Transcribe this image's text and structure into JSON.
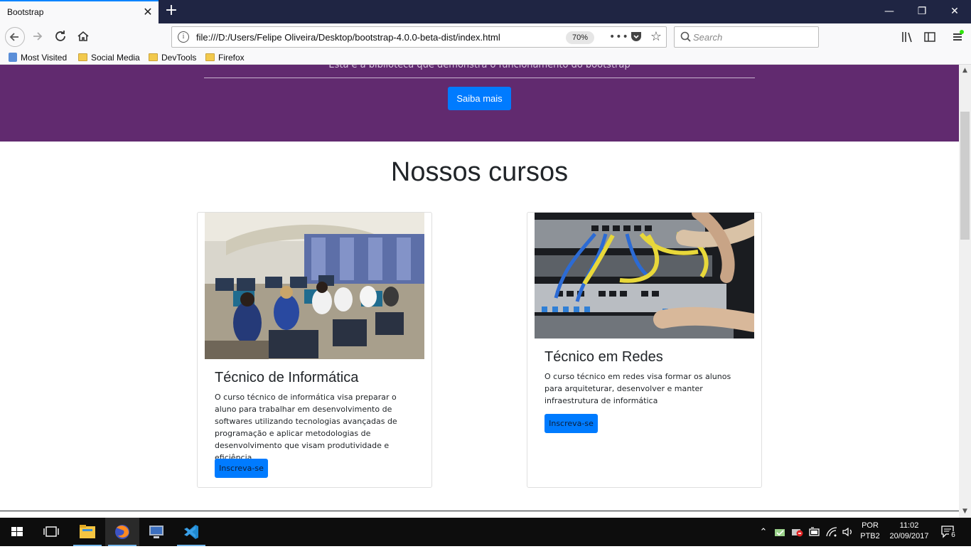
{
  "browser": {
    "tab_title": "Bootstrap",
    "tab_close": "✕",
    "new_tab": "+",
    "url": "file:///D:/Users/Felipe Oliveira/Desktop/bootstrap-4.0.0-beta-dist/index.html",
    "zoom": "70%",
    "search_placeholder": "Search",
    "bookmarks": [
      "Most Visited",
      "Social Media",
      "DevTools",
      "Firefox"
    ],
    "window_controls": [
      "—",
      "❐",
      "✕"
    ]
  },
  "page": {
    "hero_lead": "Esta é a biblioteca que demonstra o funcionamento do bootstrap",
    "hero_button": "Saiba mais",
    "section_title": "Nossos cursos",
    "courses": [
      {
        "title": "Técnico de Informática",
        "text": "O curso técnico de informática visa preparar o aluno para trabalhar em desenvolvimento de softwares utilizando tecnologias avançadas de programação e aplicar metodologias de desenvolvimento que visam produtividade e eficiência",
        "button": "Inscreva-se"
      },
      {
        "title": "Técnico em Redes",
        "text": "O curso técnico em redes visa formar os alunos para arquiteturar, desenvolver e manter infraestrutura de informática",
        "button": "Inscreva-se"
      }
    ]
  },
  "taskbar": {
    "language_top": "POR",
    "language_bottom": "PTB2",
    "time": "11:02",
    "date": "20/09/2017",
    "notifications": "6"
  },
  "colors": {
    "hero_bg": "#612a6f",
    "primary": "#007bff",
    "tab_accent": "#0a84ff",
    "titlebar_bg": "#1f2543"
  }
}
